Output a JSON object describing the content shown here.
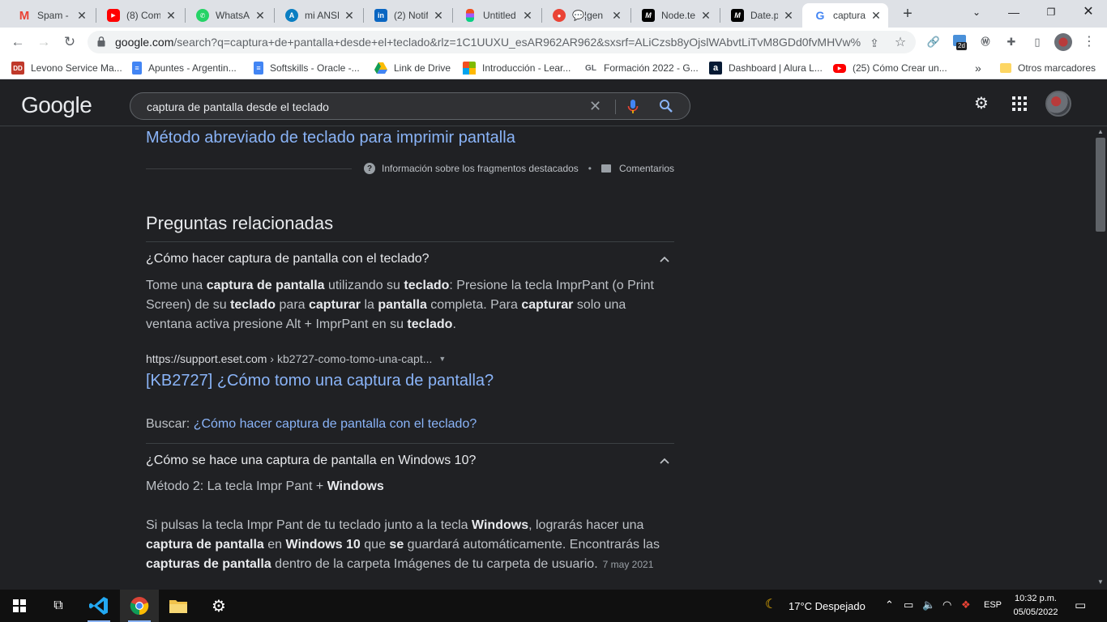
{
  "browser": {
    "tabs": [
      {
        "label": "Spam - c",
        "icon": "gmail-icon",
        "active": false
      },
      {
        "label": "(8) Com",
        "icon": "youtube-icon",
        "active": false
      },
      {
        "label": "WhatsAp",
        "icon": "whatsapp-icon",
        "active": false
      },
      {
        "label": "mi ANSE",
        "icon": "anses-icon",
        "active": false
      },
      {
        "label": "(2) Notif",
        "icon": "linkedin-icon",
        "active": false
      },
      {
        "label": "Untitled",
        "icon": "figma-icon",
        "active": false
      },
      {
        "label": "¦gen",
        "icon": "chat-icon",
        "active": false
      },
      {
        "label": "Node.te",
        "icon": "medium-icon",
        "active": false
      },
      {
        "label": "Date.pro",
        "icon": "medium-icon",
        "active": false
      },
      {
        "label": "captura",
        "icon": "google-icon",
        "active": true
      }
    ],
    "url_host": "google.com",
    "url_rest": "/search?q=captura+de+pantalla+desde+el+teclado&rlz=1C1UUXU_esAR962AR962&sxsrf=ALiCzsb8yOjslWAbvtLiTvM8GDd0fvMHVw%...",
    "extension_badge": "2d",
    "bookmarks": [
      {
        "label": "Levono Service Ma...",
        "icon": "lenovo-icon"
      },
      {
        "label": "Apuntes - Argentin...",
        "icon": "docs-icon"
      },
      {
        "label": "Softskills - Oracle -...",
        "icon": "docs-icon"
      },
      {
        "label": "Link de Drive",
        "icon": "drive-icon"
      },
      {
        "label": "Introducción - Lear...",
        "icon": "microsoft-icon"
      },
      {
        "label": "Formación 2022 - G...",
        "icon": "gl-icon"
      },
      {
        "label": "Dashboard | Alura L...",
        "icon": "alura-icon"
      },
      {
        "label": "(25) Cómo Crear un...",
        "icon": "youtube-icon"
      }
    ],
    "bookmarks_more": "»",
    "other_bookmarks": "Otros marcadores"
  },
  "google": {
    "logo": "Google",
    "query": "captura de pantalla desde el teclado"
  },
  "results": {
    "top_link": "Método abreviado de teclado para imprimir pantalla",
    "snippet_info": "Información sobre los fragmentos destacados",
    "feedback": "Comentarios",
    "related_title": "Preguntas relacionadas",
    "q1": {
      "question": "¿Cómo hacer captura de pantalla con el teclado?",
      "answer_parts": [
        {
          "t": "Tome una ",
          "b": false
        },
        {
          "t": "captura de pantalla",
          "b": true
        },
        {
          "t": " utilizando su ",
          "b": false
        },
        {
          "t": "teclado",
          "b": true
        },
        {
          "t": ": Presione la tecla ImprPant (o Print Screen) de su ",
          "b": false
        },
        {
          "t": "teclado",
          "b": true
        },
        {
          "t": " para ",
          "b": false
        },
        {
          "t": "capturar",
          "b": true
        },
        {
          "t": " la ",
          "b": false
        },
        {
          "t": "pantalla",
          "b": true
        },
        {
          "t": " completa. Para ",
          "b": false
        },
        {
          "t": "capturar",
          "b": true
        },
        {
          "t": " solo una ventana activa presione Alt + ImprPant en su ",
          "b": false
        },
        {
          "t": "teclado",
          "b": true
        },
        {
          "t": ".",
          "b": false
        }
      ],
      "cite_site": "https://support.eset.com",
      "cite_path": "› kb2727-como-tomo-una-capt...",
      "result_title": "[KB2727] ¿Cómo tomo una captura de pantalla?",
      "search_prefix": "Buscar: ",
      "search_link": "¿Cómo hacer captura de pantalla con el teclado?"
    },
    "q2": {
      "question": "¿Cómo se hace una captura de pantalla en Windows 10?",
      "method_prefix": "Método 2: La tecla Impr Pant + ",
      "method_bold": "Windows",
      "answer_parts": [
        {
          "t": "Si pulsas la tecla Impr Pant de tu teclado junto a la tecla ",
          "b": false
        },
        {
          "t": "Windows",
          "b": true
        },
        {
          "t": ", lograrás hacer una ",
          "b": false
        },
        {
          "t": "captura de pantalla",
          "b": true
        },
        {
          "t": " en ",
          "b": false
        },
        {
          "t": "Windows 10",
          "b": true
        },
        {
          "t": " que ",
          "b": false
        },
        {
          "t": "se",
          "b": true
        },
        {
          "t": " guardará automáticamente. Encontrarás las ",
          "b": false
        },
        {
          "t": "capturas de pantalla",
          "b": true
        },
        {
          "t": " dentro de la carpeta Imágenes de tu carpeta de usuario.",
          "b": false
        }
      ],
      "date": "7 may 2021"
    }
  },
  "taskbar": {
    "weather": "17°C  Despejado",
    "language": "ESP",
    "time": "10:32 p.m.",
    "date": "05/05/2022"
  }
}
